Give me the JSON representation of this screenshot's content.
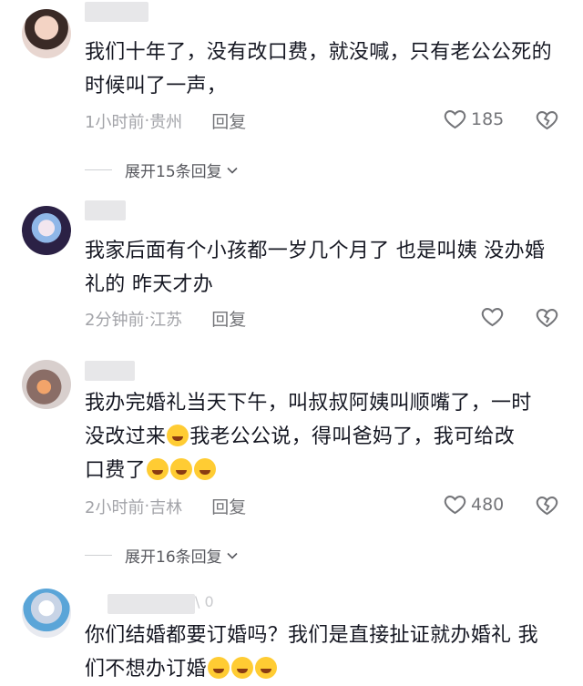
{
  "comments": [
    {
      "text": "我们十年了，没有改口费，就没喊，只有老公公死的时候叫了一声，",
      "time": "1小时前",
      "location": "贵州",
      "reply_label": "回复",
      "likes": "185",
      "expand_label": "展开15条回复"
    },
    {
      "text": "我家后面有个小孩都一岁几个月了 也是叫姨 没办婚礼的 昨天才办",
      "time": "2分钟前",
      "location": "江苏",
      "reply_label": "回复"
    },
    {
      "text_line1": "我办完婚礼当天下午，叫叔叔阿姨叫顺嘴了，一时",
      "text_line2a": "没改过来",
      "text_line2b": "我老公公说，得叫爸妈了，我可给改",
      "text_line3": "口费了",
      "time": "2小时前",
      "location": "吉林",
      "reply_label": "回复",
      "likes": "480",
      "expand_label": "展开16条回复"
    },
    {
      "text_line1": "你们结婚都要订婚吗？我们是直接扯证就办婚礼 我",
      "text_line2": "们不想办订婚",
      "name_fragment": "\\ 0"
    }
  ],
  "separator": " · ",
  "icons": {
    "like": "heart-outline-icon",
    "dislike": "broken-heart-icon",
    "expand": "chevron-down-icon",
    "emoji": "rofl-emoji-icon"
  },
  "colors": {
    "text": "#161823",
    "meta": "#a2a3a8",
    "expand": "#57585e"
  }
}
